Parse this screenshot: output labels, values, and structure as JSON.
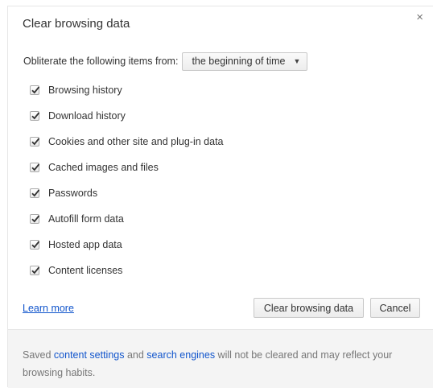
{
  "dialog": {
    "title": "Clear browsing data",
    "close_label": "×"
  },
  "range": {
    "label": "Obliterate the following items from:",
    "selected": "the beginning of time",
    "arrow": "▼"
  },
  "items": [
    {
      "label": "Browsing history",
      "checked": true
    },
    {
      "label": "Download history",
      "checked": true
    },
    {
      "label": "Cookies and other site and plug-in data",
      "checked": true
    },
    {
      "label": "Cached images and files",
      "checked": true
    },
    {
      "label": "Passwords",
      "checked": true
    },
    {
      "label": "Autofill form data",
      "checked": true
    },
    {
      "label": "Hosted app data",
      "checked": true
    },
    {
      "label": "Content licenses",
      "checked": true
    }
  ],
  "actions": {
    "learn_more": "Learn more",
    "clear_label": "Clear browsing data",
    "cancel_label": "Cancel"
  },
  "footer": {
    "prefix": "Saved ",
    "content_settings_link": "content settings",
    "middle": " and ",
    "search_engines_link": "search engines",
    "suffix": " will not be cleared and may reflect your browsing habits."
  }
}
